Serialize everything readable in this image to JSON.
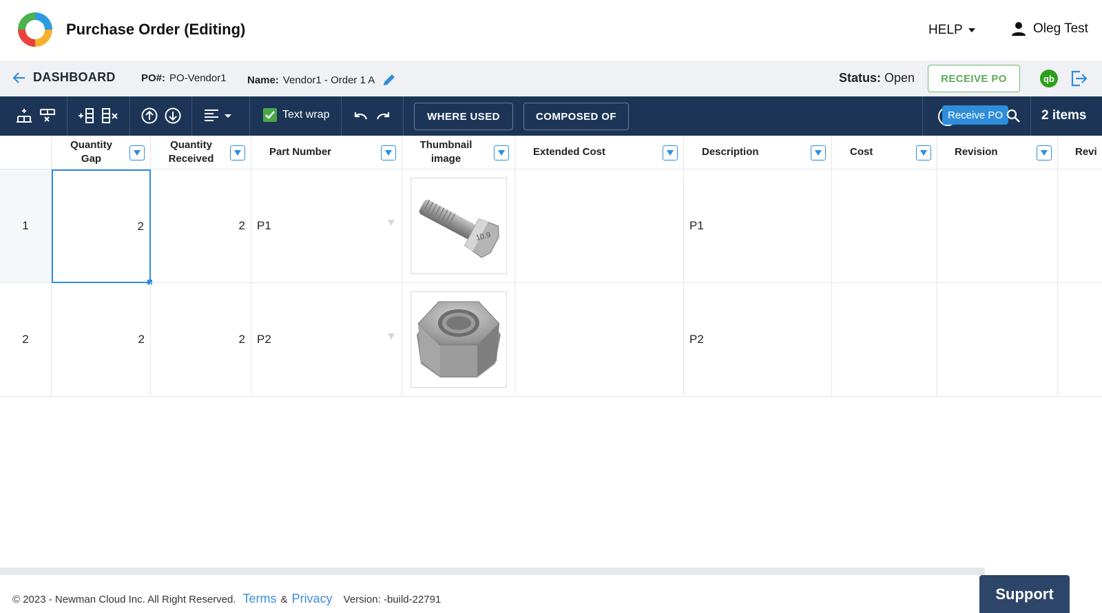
{
  "header": {
    "title": "Purchase Order (Editing)",
    "help_label": "HELP",
    "user_name": "Oleg Test"
  },
  "subheader": {
    "back_label": "DASHBOARD",
    "po_label": "PO#:",
    "po_value": "PO-Vendor1",
    "name_label": "Name:",
    "name_value": "Vendor1 - Order 1 A",
    "status_label": "Status:",
    "status_value": "Open",
    "receive_label": "RECEIVE PO",
    "qb_label": "qb"
  },
  "toolbar": {
    "text_wrap_label": "Text wrap",
    "where_used_label": "WHERE USED",
    "composed_of_label": "COMPOSED OF",
    "tooltip": "Receive PO",
    "items_count": "2 items"
  },
  "grid": {
    "columns": [
      {
        "label": "Quantity Gap"
      },
      {
        "label": "Quantity Received"
      },
      {
        "label": "Part Number"
      },
      {
        "label": "Thumbnail image"
      },
      {
        "label": "Extended Cost"
      },
      {
        "label": "Description"
      },
      {
        "label": "Cost"
      },
      {
        "label": "Revision"
      },
      {
        "label": "Revi"
      }
    ],
    "rows": [
      {
        "index": "1",
        "qty_gap": "2",
        "qty_received": "2",
        "part_number": "P1",
        "thumbnail": "bolt-image",
        "extended_cost": "",
        "description": "P1",
        "cost": "",
        "revision": ""
      },
      {
        "index": "2",
        "qty_gap": "2",
        "qty_received": "2",
        "part_number": "P2",
        "thumbnail": "hex-nut-image",
        "extended_cost": "",
        "description": "P2",
        "cost": "",
        "revision": ""
      }
    ]
  },
  "footer": {
    "copyright": "© 2023 - Newman Cloud Inc. All Right Reserved.",
    "terms_label": "Terms",
    "amp": "&",
    "privacy_label": "Privacy",
    "version": "Version: -build-22791",
    "support_label": "Support"
  },
  "colors": {
    "toolbar_bg": "#1c3557",
    "accent_blue": "#2f8ddb",
    "receive_green": "#5aaa5a",
    "support_bg": "#2d4568"
  }
}
